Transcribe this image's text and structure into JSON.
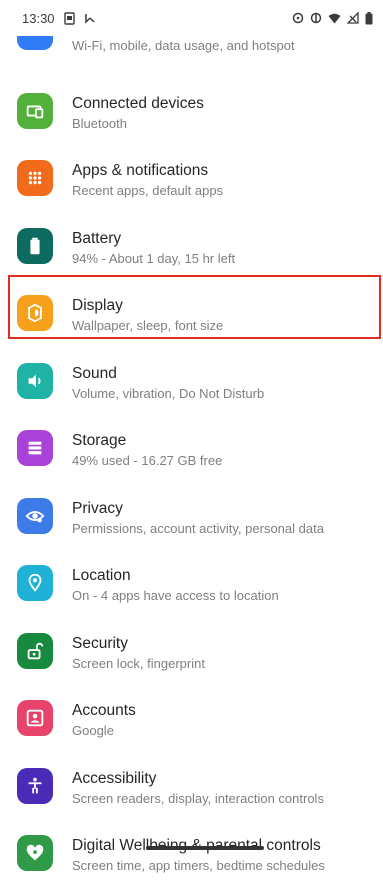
{
  "status_bar": {
    "time": "13:30",
    "icons": [
      "screenshot-icon",
      "wifi-calling-icon",
      "alarm-icon",
      "data-saver-icon",
      "wifi-icon",
      "signal-icon",
      "battery-icon"
    ]
  },
  "settings": {
    "items": [
      {
        "title": "",
        "subtitle": "Wi-Fi, mobile, data usage, and hotspot",
        "icon": "network-icon",
        "color": "#2f7cf6"
      },
      {
        "title": "Connected devices",
        "subtitle": "Bluetooth",
        "icon": "connected-devices-icon",
        "color": "#52b03b"
      },
      {
        "title": "Apps & notifications",
        "subtitle": "Recent apps, default apps",
        "icon": "apps-grid-icon",
        "color": "#f26a1c"
      },
      {
        "title": "Battery",
        "subtitle": "94% - About 1 day, 15 hr left",
        "icon": "battery-icon",
        "color": "#0d6b5f"
      },
      {
        "title": "Display",
        "subtitle": "Wallpaper, sleep, font size",
        "icon": "brightness-icon",
        "color": "#f6a01c"
      },
      {
        "title": "Sound",
        "subtitle": "Volume, vibration, Do Not Disturb",
        "icon": "volume-icon",
        "color": "#1fb3a5"
      },
      {
        "title": "Storage",
        "subtitle": "49% used - 16.27 GB free",
        "icon": "storage-icon",
        "color": "#a942d6"
      },
      {
        "title": "Privacy",
        "subtitle": "Permissions, account activity, personal data",
        "icon": "privacy-eye-icon",
        "color": "#3d7be6"
      },
      {
        "title": "Location",
        "subtitle": "On - 4 apps have access to location",
        "icon": "location-pin-icon",
        "color": "#1fb2d6"
      },
      {
        "title": "Security",
        "subtitle": "Screen lock, fingerprint",
        "icon": "lock-open-icon",
        "color": "#188a3f"
      },
      {
        "title": "Accounts",
        "subtitle": "Google",
        "icon": "account-box-icon",
        "color": "#e8436a"
      },
      {
        "title": "Accessibility",
        "subtitle": "Screen readers, display, interaction controls",
        "icon": "accessibility-icon",
        "color": "#4a2bb5"
      },
      {
        "title": "Digital Wellbeing & parental controls",
        "subtitle": "Screen time, app timers, bedtime schedules",
        "icon": "wellbeing-heart-icon",
        "color": "#2f9a47"
      }
    ]
  },
  "highlight_item": "Display",
  "highlight_color": "#e02b1f"
}
